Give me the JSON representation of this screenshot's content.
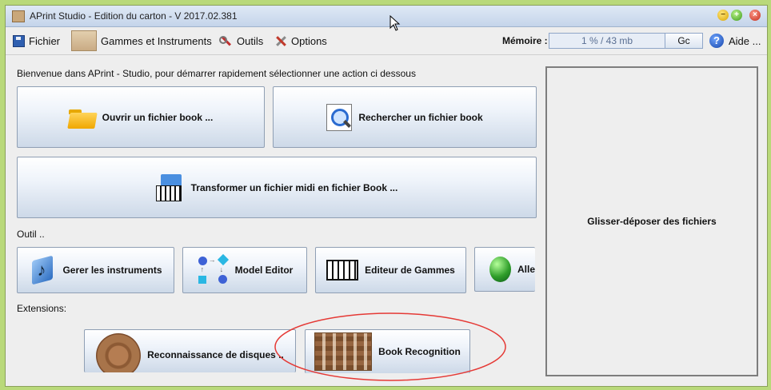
{
  "window": {
    "title": "APrint Studio - Edition du carton  - V 2017.02.381",
    "controls": {
      "minimize": "−",
      "maximize": "+",
      "close": "×"
    }
  },
  "menubar": {
    "fichier": "Fichier",
    "gammes": "Gammes et Instruments",
    "outils": "Outils",
    "options": "Options",
    "memory_label": "Mémoire :",
    "memory_value": "1 % / 43 mb",
    "gc_label": "Gc",
    "help_icon_glyph": "?",
    "help_label": "Aide ..."
  },
  "main": {
    "welcome_text": "Bienvenue dans APrint - Studio, pour démarrer rapidement sélectionner une action ci dessous",
    "actions": {
      "open_book": "Ouvrir un fichier book ...",
      "search_book": "Rechercher un fichier book",
      "midi_to_book": "Transformer un fichier midi en fichier Book ..."
    },
    "tools_header": "Outil ..",
    "tools": {
      "instruments": "Gerer les instruments",
      "model_editor": "Model Editor",
      "scale_editor": "Editeur de Gammes",
      "partial": "Alle"
    },
    "extensions_header": "Extensions:",
    "extensions": {
      "disc_recognition": "Reconnaissance de disques ..",
      "book_recognition": "Book Recognition"
    }
  },
  "dropzone": {
    "label": "Glisser-déposer des fichiers"
  },
  "colors": {
    "highlight_ellipse": "#e53935",
    "window_border": "#b9d97a"
  },
  "icons": [
    "save-icon",
    "gammes-icon",
    "tools-icon",
    "options-icon",
    "help-icon",
    "folder-icon",
    "search-file-icon",
    "midi-file-icon",
    "instrument-icon",
    "model-editor-icon",
    "piano-icon",
    "globe-icon",
    "disc-icon",
    "book-scan-icon"
  ]
}
